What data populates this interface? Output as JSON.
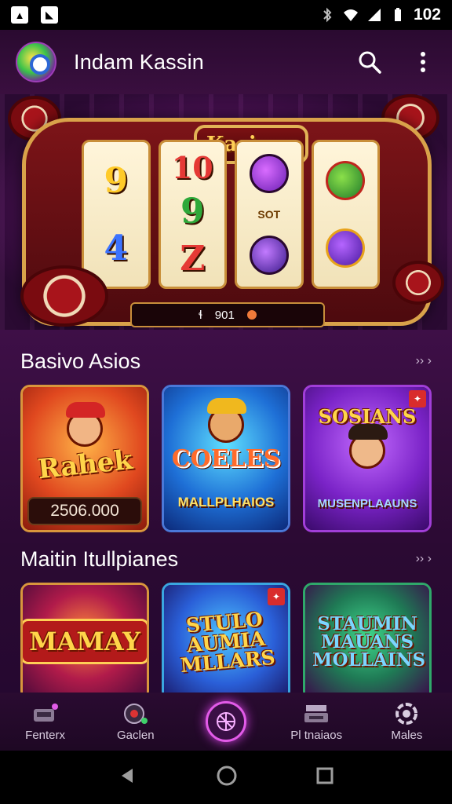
{
  "status_bar": {
    "time": "102",
    "left_icons": [
      "app-notification-icon",
      "photo-notification-icon"
    ],
    "right_icons": [
      "bluetooth-icon",
      "wifi-icon",
      "signal-icon",
      "battery-icon"
    ]
  },
  "app_bar": {
    "title": "Indam Kassin",
    "actions": [
      "search-icon",
      "more-vert-icon"
    ]
  },
  "hero": {
    "marquee_text": "Kasinsa",
    "reels": [
      {
        "top": "9",
        "bottom": "4"
      },
      {
        "top": "10",
        "middle": "9",
        "bottom": "Z"
      },
      {
        "middle": "SOT"
      },
      {}
    ],
    "bar_left": "ɬ",
    "bar_text": "901"
  },
  "sections": [
    {
      "title": "Basivo Asios",
      "more": "›› ›",
      "cards": [
        {
          "title": "Rahek",
          "footer": "2506.000"
        },
        {
          "title": "COELES",
          "subtitle": "MALLPLHAIOS"
        },
        {
          "title": "SOSIANS",
          "subtitle": "MUSENPLAAUNS"
        }
      ]
    },
    {
      "title": "Maitin Itullpianes",
      "more": "›› ›",
      "cards": [
        {
          "title": "MAMAY"
        },
        {
          "title": "STULO AUMIA MLLARS"
        },
        {
          "title": "STAUMIN MAUANS MOLLAINS"
        }
      ]
    }
  ],
  "bottom_nav": {
    "items": [
      {
        "label": "Fenterx",
        "icon": "slot-machine-icon"
      },
      {
        "label": "Gaclen",
        "icon": "roulette-icon"
      },
      {
        "label": "",
        "icon": "target-icon"
      },
      {
        "label": "Pl tnaiaos",
        "icon": "cash-register-icon"
      },
      {
        "label": "Males",
        "icon": "settings-icon"
      }
    ]
  },
  "colors": {
    "accent": "#e25be8",
    "background": "#2b0a33",
    "gold": "#ffd54a"
  }
}
